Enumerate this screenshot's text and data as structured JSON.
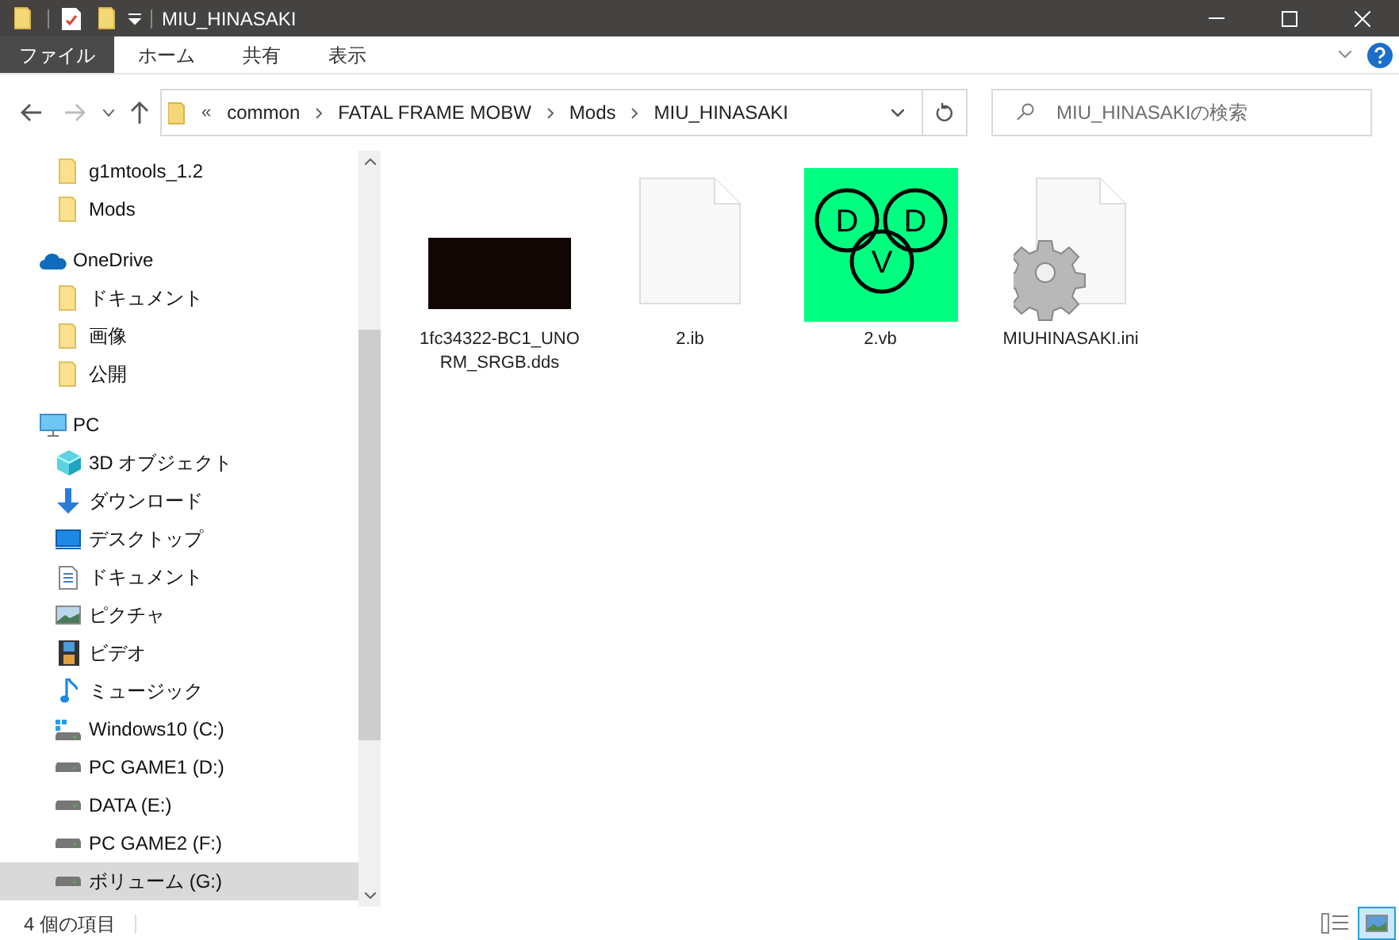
{
  "window": {
    "title": "MIU_HINASAKI"
  },
  "ribbon_tabs": [
    {
      "label": "ファイル",
      "selected": true
    },
    {
      "label": "ホーム",
      "selected": false
    },
    {
      "label": "共有",
      "selected": false
    },
    {
      "label": "表示",
      "selected": false
    }
  ],
  "address_bar": {
    "overflow": "«",
    "crumbs": [
      "common",
      "FATAL FRAME MOBW",
      "Mods",
      "MIU_HINASAKI"
    ]
  },
  "search": {
    "placeholder": "MIU_HINASAKIの検索"
  },
  "sidebar": {
    "items": [
      {
        "label": "g1mtools_1.2",
        "kind": "folder",
        "selected": false
      },
      {
        "label": "Mods",
        "kind": "folder",
        "selected": false
      },
      {
        "label": "OneDrive",
        "kind": "cloud",
        "selected": false,
        "children": [
          {
            "label": "ドキュメント",
            "kind": "folder",
            "selected": false
          },
          {
            "label": "画像",
            "kind": "folder",
            "selected": false
          },
          {
            "label": "公開",
            "kind": "folder",
            "selected": false
          }
        ]
      },
      {
        "label": "PC",
        "kind": "pc",
        "selected": false,
        "children": [
          {
            "label": "3D オブジェクト",
            "kind": "cube",
            "selected": false
          },
          {
            "label": "ダウンロード",
            "kind": "download",
            "selected": false
          },
          {
            "label": "デスクトップ",
            "kind": "desktop",
            "selected": false
          },
          {
            "label": "ドキュメント",
            "kind": "document",
            "selected": false
          },
          {
            "label": "ピクチャ",
            "kind": "picture",
            "selected": false
          },
          {
            "label": "ビデオ",
            "kind": "video",
            "selected": false
          },
          {
            "label": "ミュージック",
            "kind": "music",
            "selected": false
          },
          {
            "label": "Windows10 (C:)",
            "kind": "windrive",
            "selected": false
          },
          {
            "label": "PC GAME1 (D:)",
            "kind": "drive",
            "selected": false
          },
          {
            "label": "DATA (E:)",
            "kind": "drive",
            "selected": false
          },
          {
            "label": "PC GAME2 (F:)",
            "kind": "drive",
            "selected": false
          },
          {
            "label": "ボリューム (G:)",
            "kind": "drive",
            "selected": true
          }
        ]
      }
    ]
  },
  "files": [
    {
      "name": "1fc34322-BC1_UNORM_SRGB.dds",
      "kind": "thumbnail"
    },
    {
      "name": "2.ib",
      "kind": "blank"
    },
    {
      "name": "2.vb",
      "kind": "dvd",
      "logo_letters": [
        "D",
        "D",
        "V"
      ]
    },
    {
      "name": "MIUHINASAKI.ini",
      "kind": "settings"
    }
  ],
  "status_bar": {
    "count": "4 個の項目"
  }
}
